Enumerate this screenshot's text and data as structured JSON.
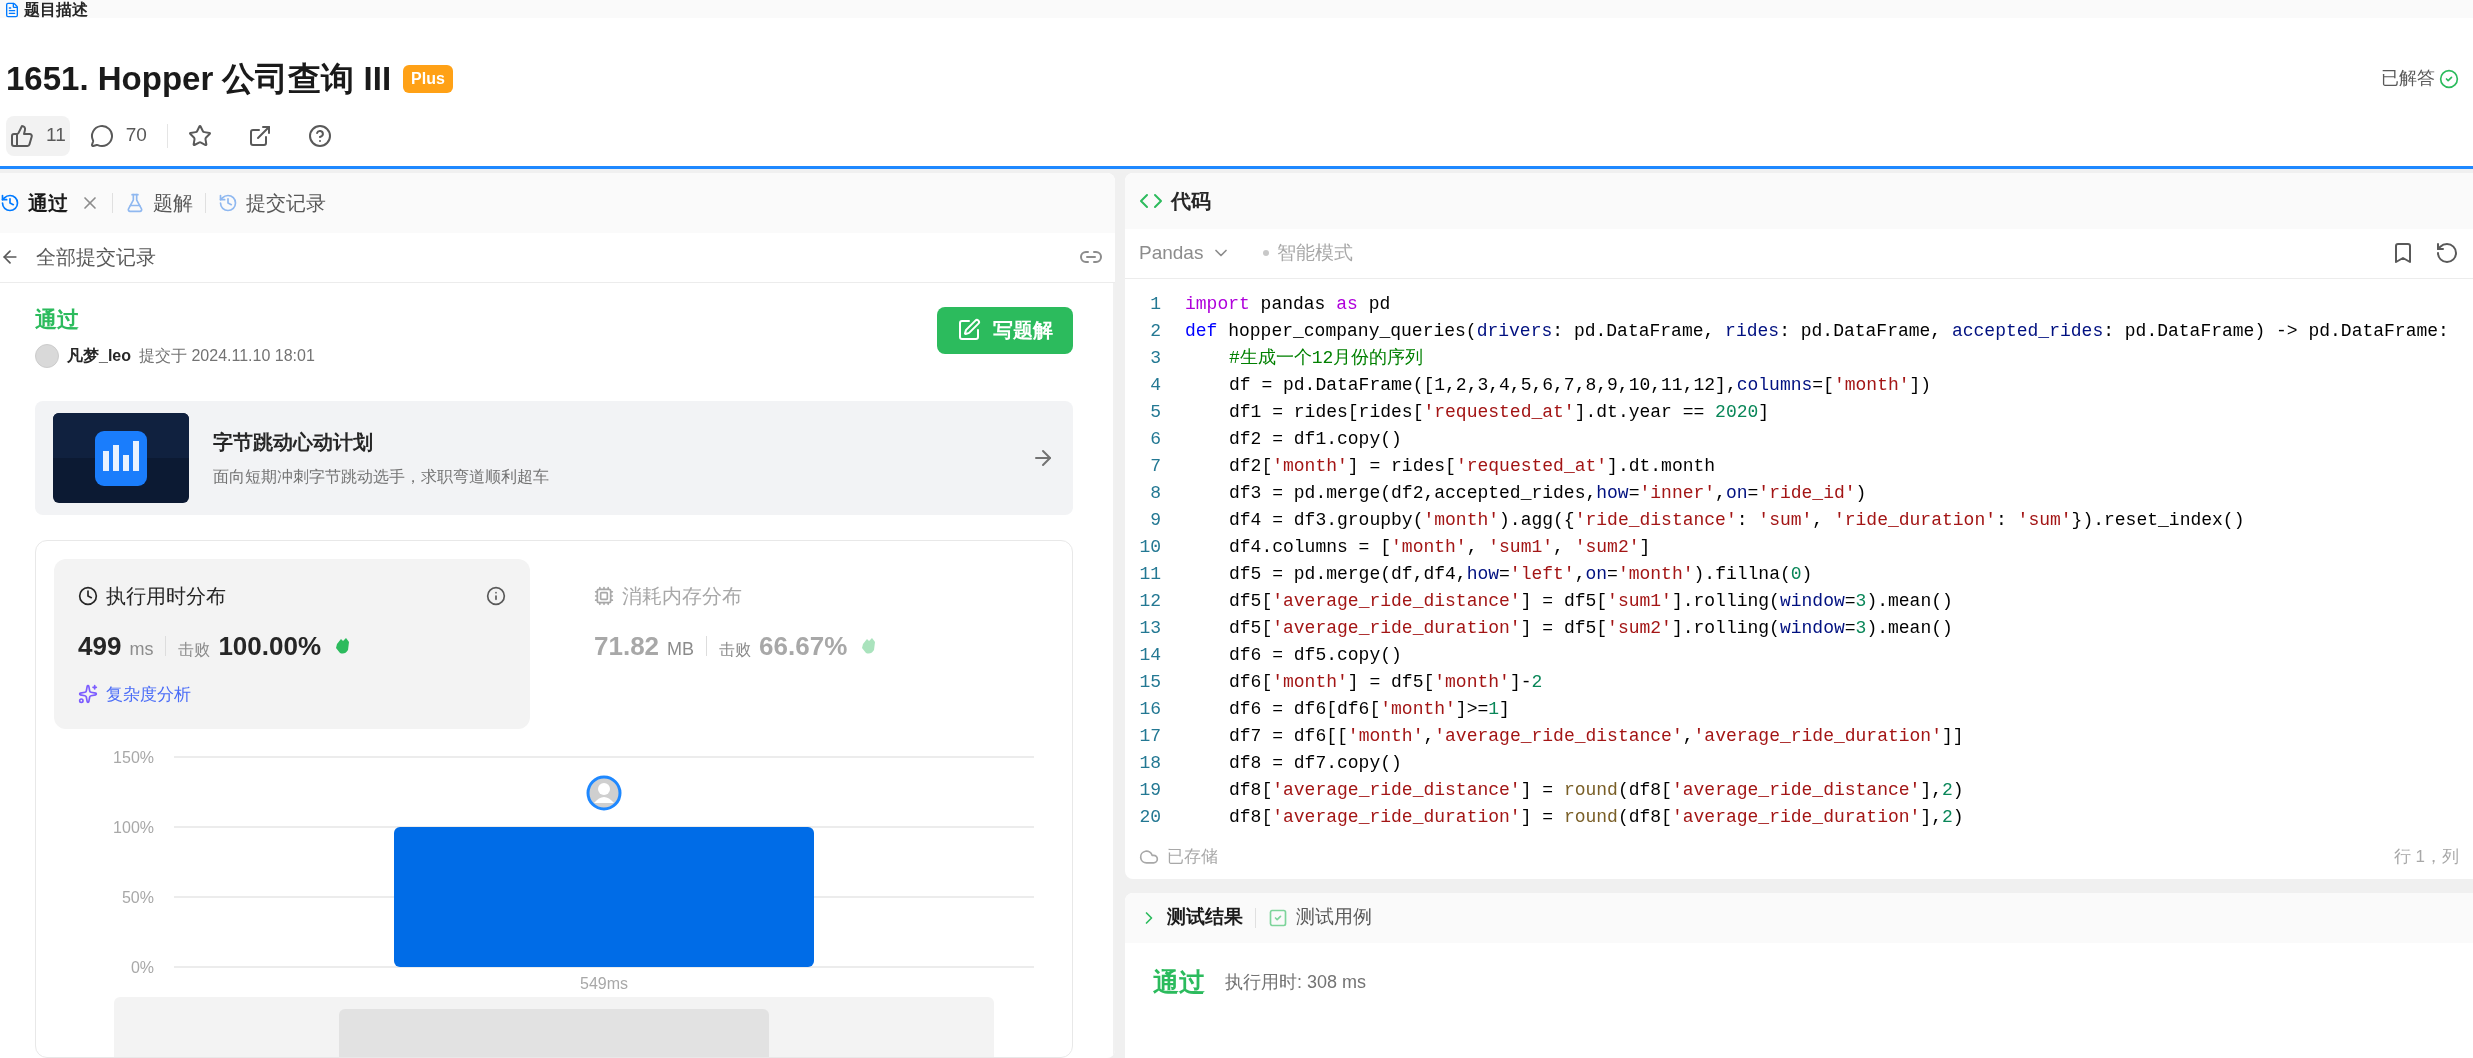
{
  "top_tab": {
    "label": "题目描述"
  },
  "problem": {
    "title": "1651. Hopper 公司查询 III",
    "badge": "Plus",
    "status": "已解答",
    "likes": "11",
    "comments": "70"
  },
  "left_tabs": [
    {
      "label": "通过",
      "selected": true,
      "closable": true
    },
    {
      "label": "题解",
      "selected": false,
      "closable": false
    },
    {
      "label": "提交记录",
      "selected": false,
      "closable": false
    }
  ],
  "back_link": "全部提交记录",
  "submission": {
    "result": "通过",
    "user": "凡梦_leo",
    "submitted": "提交于 2024.11.10 18:01",
    "write_button": "写题解"
  },
  "promo": {
    "title": "字节跳动心动计划",
    "subtitle": "面向短期冲刺字节跳动选手，求职弯道顺利超车"
  },
  "stats": [
    {
      "title": "执行用时分布",
      "value": "499",
      "unit": "ms",
      "beat_label": "击败",
      "beat": "100.00%",
      "selected": true,
      "analysis": "复杂度分析"
    },
    {
      "title": "消耗内存分布",
      "value": "71.82",
      "unit": "MB",
      "beat_label": "击败",
      "beat": "66.67%",
      "selected": false
    }
  ],
  "chart_data": {
    "type": "bar",
    "categories": [
      "549ms"
    ],
    "values": [
      100
    ],
    "ylim": [
      0,
      150
    ],
    "yticks": [
      {
        "value": 0,
        "label": "0%"
      },
      {
        "value": 50,
        "label": "50%"
      },
      {
        "value": 100,
        "label": "100%"
      },
      {
        "value": 150,
        "label": "150%"
      }
    ]
  },
  "code_panel": {
    "title": "代码",
    "language": "Pandas",
    "mode": "智能模式",
    "saved": "已存储",
    "cursor": "行 1，列"
  },
  "code_lines": [
    {
      "n": "1",
      "tokens": [
        {
          "t": "import",
          "kind": "keyword"
        },
        {
          "t": " pandas ",
          "kind": "plain"
        },
        {
          "t": "as",
          "kind": "keyword"
        },
        {
          "t": " pd",
          "kind": "plain"
        }
      ]
    },
    {
      "n": "2",
      "tokens": [
        {
          "t": "def",
          "kind": "def"
        },
        {
          "t": " hopper_company_queries(",
          "kind": "plain"
        },
        {
          "t": "drivers",
          "kind": "param"
        },
        {
          "t": ": pd.DataFrame, ",
          "kind": "plain"
        },
        {
          "t": "rides",
          "kind": "param"
        },
        {
          "t": ": pd.DataFrame, ",
          "kind": "plain"
        },
        {
          "t": "accepted_rides",
          "kind": "param"
        },
        {
          "t": ": pd.DataFrame) -> pd.DataFrame:",
          "kind": "plain"
        }
      ],
      "children": [
        {
          "n": "3",
          "tokens": [
            {
              "t": "#生成一个12月份的序列",
              "kind": "comment"
            }
          ]
        },
        {
          "n": "4",
          "tokens": [
            {
              "t": "df = pd.DataFrame([1,2,3,4,5,6,7,8,9,10,11,12],",
              "kind": "plain"
            },
            {
              "t": "columns",
              "kind": "param"
            },
            {
              "t": "=[",
              "kind": "plain"
            },
            {
              "t": "'month'",
              "kind": "string"
            },
            {
              "t": "])",
              "kind": "plain"
            }
          ]
        },
        {
          "n": "5",
          "tokens": [
            {
              "t": "df1 = rides[rides[",
              "kind": "plain"
            },
            {
              "t": "'requested_at'",
              "kind": "string"
            },
            {
              "t": "].dt.year == ",
              "kind": "plain"
            },
            {
              "t": "2020",
              "kind": "number"
            },
            {
              "t": "]",
              "kind": "plain"
            }
          ]
        },
        {
          "n": "6",
          "tokens": [
            {
              "t": "df2 = df1.copy()",
              "kind": "plain"
            }
          ]
        },
        {
          "n": "7",
          "tokens": [
            {
              "t": "df2[",
              "kind": "plain"
            },
            {
              "t": "'month'",
              "kind": "string"
            },
            {
              "t": "] = rides[",
              "kind": "plain"
            },
            {
              "t": "'requested_at'",
              "kind": "string"
            },
            {
              "t": "].dt.month",
              "kind": "plain"
            }
          ]
        },
        {
          "n": "8",
          "tokens": [
            {
              "t": "df3 = pd.merge(df2,accepted_rides,",
              "kind": "plain"
            },
            {
              "t": "how",
              "kind": "param"
            },
            {
              "t": "=",
              "kind": "plain"
            },
            {
              "t": "'inner'",
              "kind": "string"
            },
            {
              "t": ",",
              "kind": "plain"
            },
            {
              "t": "on",
              "kind": "param"
            },
            {
              "t": "=",
              "kind": "plain"
            },
            {
              "t": "'ride_id'",
              "kind": "string"
            },
            {
              "t": ")",
              "kind": "plain"
            }
          ]
        },
        {
          "n": "9",
          "tokens": [
            {
              "t": "df4 = df3.groupby(",
              "kind": "plain"
            },
            {
              "t": "'month'",
              "kind": "string"
            },
            {
              "t": ").agg({",
              "kind": "plain"
            },
            {
              "t": "'ride_distance'",
              "kind": "string"
            },
            {
              "t": ": ",
              "kind": "plain"
            },
            {
              "t": "'sum'",
              "kind": "string"
            },
            {
              "t": ", ",
              "kind": "plain"
            },
            {
              "t": "'ride_duration'",
              "kind": "string"
            },
            {
              "t": ": ",
              "kind": "plain"
            },
            {
              "t": "'sum'",
              "kind": "string"
            },
            {
              "t": "}).reset_index()",
              "kind": "plain"
            }
          ]
        },
        {
          "n": "10",
          "tokens": [
            {
              "t": "df4.columns = [",
              "kind": "plain"
            },
            {
              "t": "'month'",
              "kind": "string"
            },
            {
              "t": ", ",
              "kind": "plain"
            },
            {
              "t": "'sum1'",
              "kind": "string"
            },
            {
              "t": ", ",
              "kind": "plain"
            },
            {
              "t": "'sum2'",
              "kind": "string"
            },
            {
              "t": "]",
              "kind": "plain"
            }
          ]
        },
        {
          "n": "11",
          "tokens": [
            {
              "t": "df5 = pd.merge(df,df4,",
              "kind": "plain"
            },
            {
              "t": "how",
              "kind": "param"
            },
            {
              "t": "=",
              "kind": "plain"
            },
            {
              "t": "'left'",
              "kind": "string"
            },
            {
              "t": ",",
              "kind": "plain"
            },
            {
              "t": "on",
              "kind": "param"
            },
            {
              "t": "=",
              "kind": "plain"
            },
            {
              "t": "'month'",
              "kind": "string"
            },
            {
              "t": ").fillna(",
              "kind": "plain"
            },
            {
              "t": "0",
              "kind": "number"
            },
            {
              "t": ")",
              "kind": "plain"
            }
          ]
        },
        {
          "n": "12",
          "tokens": [
            {
              "t": "df5[",
              "kind": "plain"
            },
            {
              "t": "'average_ride_distance'",
              "kind": "string"
            },
            {
              "t": "] = df5[",
              "kind": "plain"
            },
            {
              "t": "'sum1'",
              "kind": "string"
            },
            {
              "t": "].rolling(",
              "kind": "plain"
            },
            {
              "t": "window",
              "kind": "param"
            },
            {
              "t": "=",
              "kind": "plain"
            },
            {
              "t": "3",
              "kind": "number"
            },
            {
              "t": ").mean()",
              "kind": "plain"
            }
          ]
        },
        {
          "n": "13",
          "tokens": [
            {
              "t": "df5[",
              "kind": "plain"
            },
            {
              "t": "'average_ride_duration'",
              "kind": "string"
            },
            {
              "t": "] = df5[",
              "kind": "plain"
            },
            {
              "t": "'sum2'",
              "kind": "string"
            },
            {
              "t": "].rolling(",
              "kind": "plain"
            },
            {
              "t": "window",
              "kind": "param"
            },
            {
              "t": "=",
              "kind": "plain"
            },
            {
              "t": "3",
              "kind": "number"
            },
            {
              "t": ").mean()",
              "kind": "plain"
            }
          ]
        },
        {
          "n": "14",
          "tokens": [
            {
              "t": "df6 = df5.copy()",
              "kind": "plain"
            }
          ]
        },
        {
          "n": "15",
          "tokens": [
            {
              "t": "df6[",
              "kind": "plain"
            },
            {
              "t": "'month'",
              "kind": "string"
            },
            {
              "t": "] = df5[",
              "kind": "plain"
            },
            {
              "t": "'month'",
              "kind": "string"
            },
            {
              "t": "]-",
              "kind": "plain"
            },
            {
              "t": "2",
              "kind": "number"
            }
          ]
        },
        {
          "n": "16",
          "tokens": [
            {
              "t": "df6 = df6[df6[",
              "kind": "plain"
            },
            {
              "t": "'month'",
              "kind": "string"
            },
            {
              "t": "]>=",
              "kind": "plain"
            },
            {
              "t": "1",
              "kind": "number"
            },
            {
              "t": "]",
              "kind": "plain"
            }
          ]
        },
        {
          "n": "17",
          "tokens": [
            {
              "t": "df7 = df6[[",
              "kind": "plain"
            },
            {
              "t": "'month'",
              "kind": "string"
            },
            {
              "t": ",",
              "kind": "plain"
            },
            {
              "t": "'average_ride_distance'",
              "kind": "string"
            },
            {
              "t": ",",
              "kind": "plain"
            },
            {
              "t": "'average_ride_duration'",
              "kind": "string"
            },
            {
              "t": "]]",
              "kind": "plain"
            }
          ]
        },
        {
          "n": "18",
          "tokens": [
            {
              "t": "df8 = df7.copy()",
              "kind": "plain"
            }
          ]
        },
        {
          "n": "19",
          "tokens": [
            {
              "t": "df8[",
              "kind": "plain"
            },
            {
              "t": "'average_ride_distance'",
              "kind": "string"
            },
            {
              "t": "] = ",
              "kind": "plain"
            },
            {
              "t": "round",
              "kind": "builtin"
            },
            {
              "t": "(df8[",
              "kind": "plain"
            },
            {
              "t": "'average_ride_distance'",
              "kind": "string"
            },
            {
              "t": "],",
              "kind": "plain"
            },
            {
              "t": "2",
              "kind": "number"
            },
            {
              "t": ")",
              "kind": "plain"
            }
          ]
        },
        {
          "n": "20",
          "tokens": [
            {
              "t": "df8[",
              "kind": "plain"
            },
            {
              "t": "'average_ride_duration'",
              "kind": "string"
            },
            {
              "t": "] = ",
              "kind": "plain"
            },
            {
              "t": "round",
              "kind": "builtin"
            },
            {
              "t": "(df8[",
              "kind": "plain"
            },
            {
              "t": "'average_ride_duration'",
              "kind": "string"
            },
            {
              "t": "],",
              "kind": "plain"
            },
            {
              "t": "2",
              "kind": "number"
            },
            {
              "t": ")",
              "kind": "plain"
            }
          ]
        }
      ]
    }
  ],
  "result_tabs": [
    {
      "label": "测试结果",
      "selected": true
    },
    {
      "label": "测试用例",
      "selected": false
    }
  ],
  "result": {
    "status": "通过",
    "runtime": "执行用时: 308 ms"
  }
}
